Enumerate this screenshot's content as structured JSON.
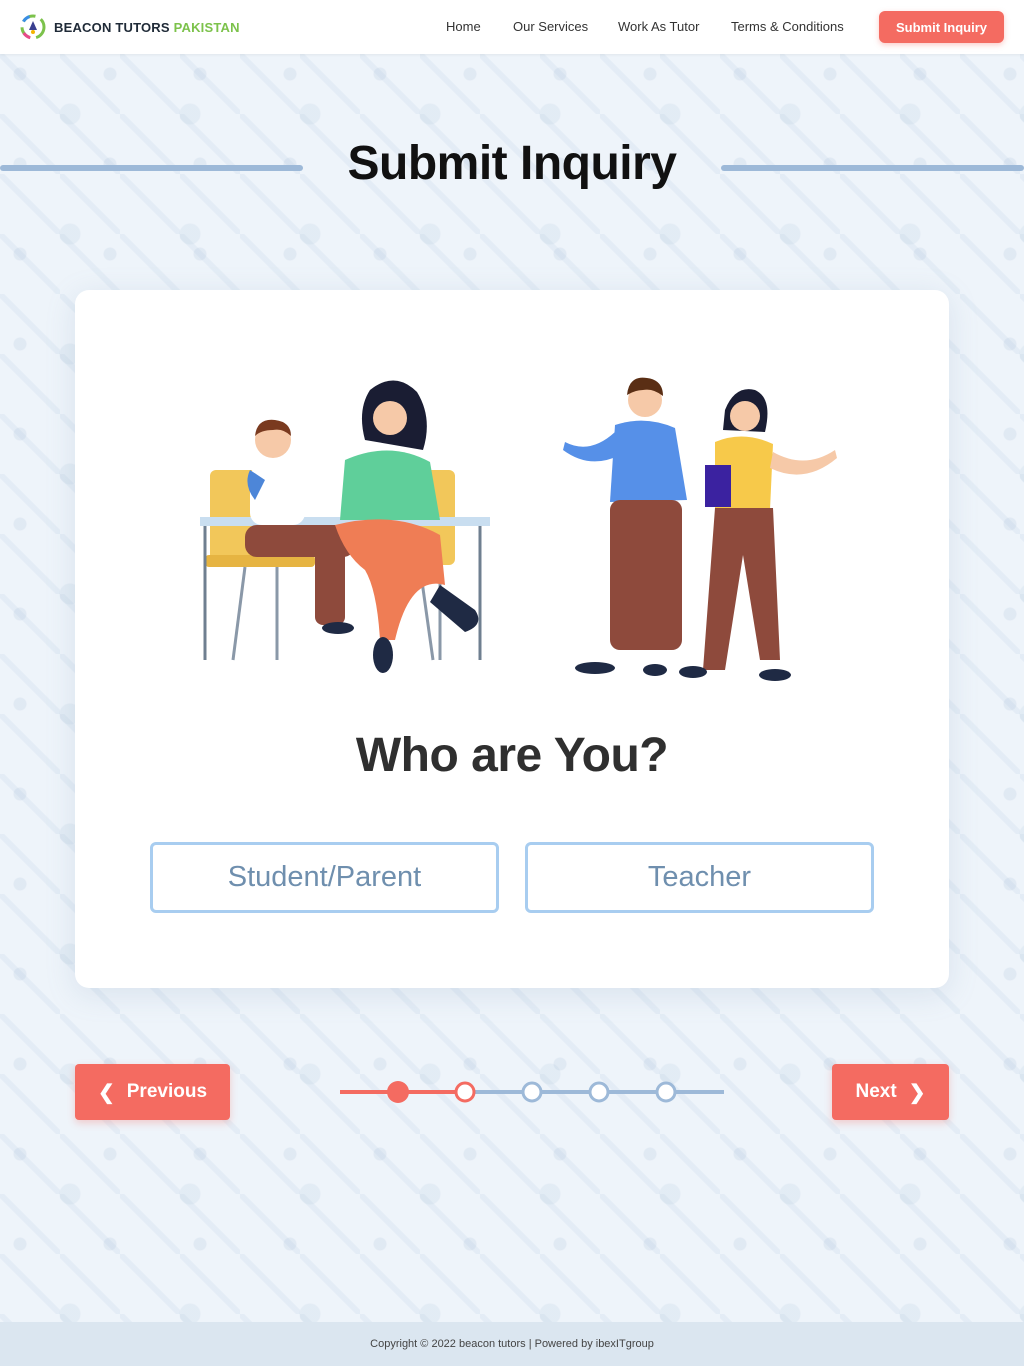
{
  "header": {
    "brand_main": "BEACON TUTORS",
    "brand_accent": "PAKISTAN",
    "nav": {
      "home": "Home",
      "services": "Our Services",
      "work_as_tutor": "Work As Tutor",
      "terms": "Terms & Conditions"
    },
    "cta_label": "Submit Inquiry"
  },
  "page": {
    "title": "Submit Inquiry"
  },
  "card": {
    "question": "Who are You?",
    "options": {
      "student_parent": "Student/Parent",
      "teacher": "Teacher"
    }
  },
  "wizard": {
    "previous_label": "Previous",
    "next_label": "Next",
    "total_steps": 5,
    "current_step": 2
  },
  "footer": {
    "copyright": "Copyright © 2022 beacon tutors | Powered by ibexITgroup"
  },
  "colors": {
    "accent": "#f46b61",
    "brand_green": "#7cc24b",
    "option_border": "#a8cdf0",
    "progress_inactive": "#9db9d8"
  }
}
